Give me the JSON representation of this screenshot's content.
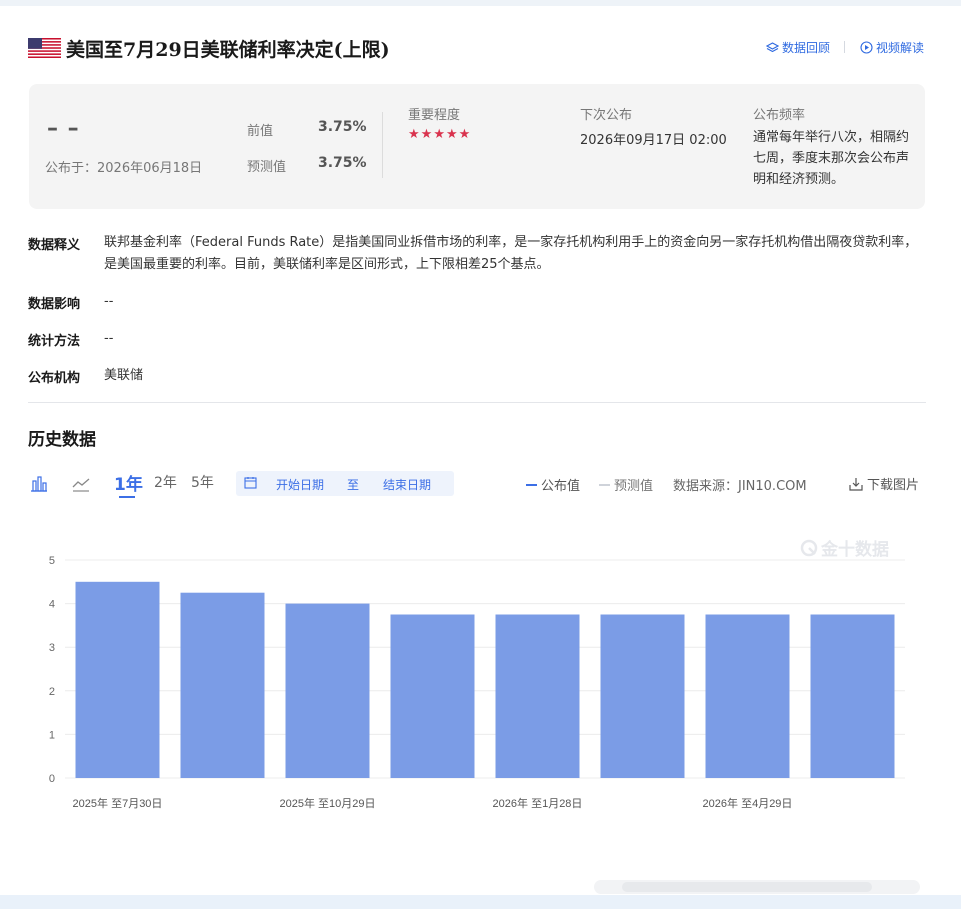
{
  "header": {
    "title": "美国至7月29日美联储利率决定(上限)",
    "links": {
      "review": "数据回顾",
      "video": "视频解读"
    }
  },
  "summary": {
    "actual": "– –",
    "publish_date": "公布于：2026年06月18日",
    "previous_label": "前值",
    "previous_value": "3.75%",
    "forecast_label": "预测值",
    "forecast_value": "3.75%",
    "importance_label": "重要程度",
    "importance_stars": 5,
    "next_label": "下次公布",
    "next_value": "2026年09月17日 02:00",
    "frequency_label": "公布频率",
    "frequency_value": "通常每年举行八次，相隔约七周，季度末那次会公布声明和经济预测。"
  },
  "definitions": {
    "def_key": "数据释义",
    "def_value": "联邦基金利率（Federal Funds Rate）是指美国同业拆借市场的利率，是一家存托机构利用手上的资金向另一家存托机构借出隔夜贷款利率，是美国最重要的利率。目前，美联储利率是区间形式，上下限相差25个基点。",
    "impact_key": "数据影响",
    "impact_value": "--",
    "method_key": "统计方法",
    "method_value": "--",
    "agency_key": "公布机构",
    "agency_value": "美联储"
  },
  "history": {
    "title": "历史数据",
    "ranges": [
      "1年",
      "2年",
      "5年"
    ],
    "active_range": "1年",
    "start_date": "开始日期",
    "to": "至",
    "end_date": "结束日期",
    "legend_published": "公布值",
    "legend_forecast": "预测值",
    "source": "数据来源：JIN10.COM",
    "download": "下载图片",
    "watermark": "金十数据"
  },
  "colors": {
    "accent": "#3c6fe6",
    "bar": "#7b9ce6",
    "star": "#d9334e",
    "panel": "#f4f4f4"
  },
  "chart_data": {
    "type": "bar",
    "categories": [
      "2025年 至7月30日",
      "",
      "2025年 至10月29日",
      "",
      "2026年 至1月28日",
      "",
      "2026年 至4月29日",
      ""
    ],
    "series": [
      {
        "name": "公布值",
        "values": [
          4.5,
          4.25,
          4.0,
          3.75,
          3.75,
          3.75,
          3.75,
          3.75
        ]
      }
    ],
    "ylim": [
      0,
      5
    ],
    "yticks": [
      0,
      1,
      2,
      3,
      4,
      5
    ],
    "grid": true
  }
}
